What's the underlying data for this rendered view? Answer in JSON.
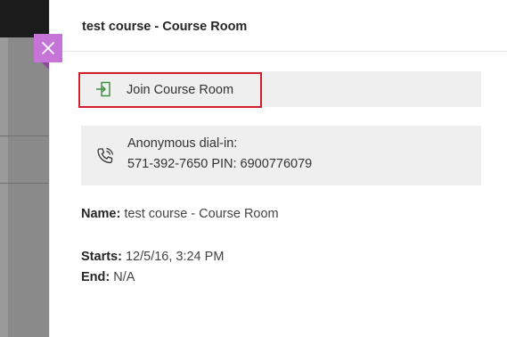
{
  "panel": {
    "title": "test course - Course Room"
  },
  "actions": {
    "join_label": "Join Course Room"
  },
  "dial_in": {
    "heading": "Anonymous dial-in:",
    "details": "571-392-7650 PIN: 6900776079"
  },
  "details": {
    "name_label": "Name:",
    "name_value": "test course - Course Room",
    "starts_label": "Starts:",
    "starts_value": "12/5/16, 3:24 PM",
    "end_label": "End:",
    "end_value": "N/A"
  },
  "colors": {
    "close_button": "#c674d8",
    "highlight_border": "#d21f2b",
    "join_icon": "#3a8a3a"
  },
  "icons": {
    "close": "close-icon",
    "join": "enter-icon",
    "phone": "phone-icon"
  }
}
